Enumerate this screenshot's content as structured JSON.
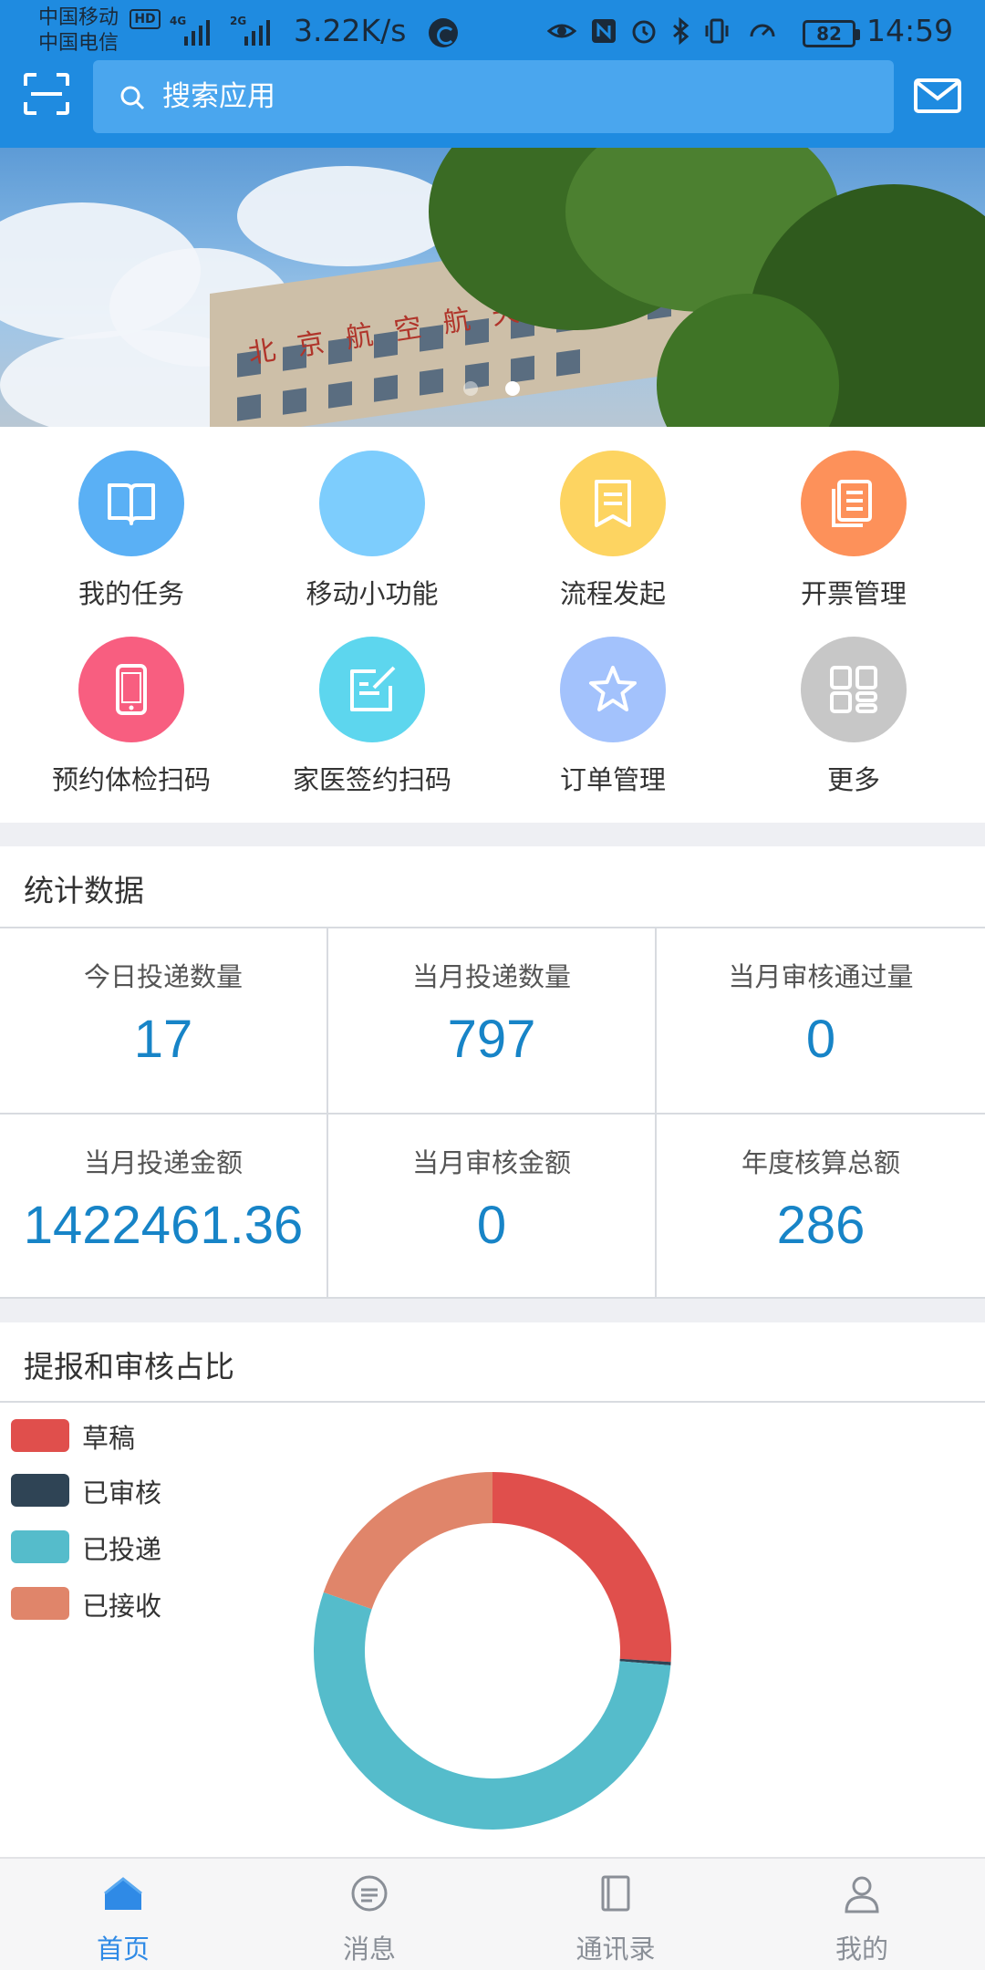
{
  "status_bar": {
    "carrier_1": "中国移动",
    "carrier_1_badge": "HD",
    "carrier_2": "中国电信",
    "signal_1_type": "4G",
    "signal_2_type": "2G",
    "net_speed": "3.22K/s",
    "battery": "82",
    "time": "14:59"
  },
  "header": {
    "search_placeholder": "搜索应用",
    "scan_icon": "scan-icon",
    "mail_icon": "mail-icon",
    "accent_color": "#1f8be0"
  },
  "banner": {
    "sign_text": "北京航空航天",
    "page_count": 2,
    "active_page": 2
  },
  "apps": [
    {
      "label": "我的任务",
      "color": "#5ab0f5",
      "icon": "book-icon"
    },
    {
      "label": "移动小功能",
      "color": "#7dcdfd",
      "icon": "blank-icon"
    },
    {
      "label": "流程发起",
      "color": "#fdd461",
      "icon": "document-icon"
    },
    {
      "label": "开票管理",
      "color": "#fd915a",
      "icon": "invoice-icon"
    },
    {
      "label": "预约体检扫码",
      "color": "#f85e80",
      "icon": "phone-icon"
    },
    {
      "label": "家医签约扫码",
      "color": "#5dd6ee",
      "icon": "edit-icon"
    },
    {
      "label": "订单管理",
      "color": "#a3c2fc",
      "icon": "star-icon"
    },
    {
      "label": "更多",
      "color": "#c7c7c7",
      "icon": "grid-icon"
    }
  ],
  "stats": {
    "title": "统计数据",
    "value_color": "#1784c7",
    "items": [
      {
        "label": "今日投递数量",
        "value": "17"
      },
      {
        "label": "当月投递数量",
        "value": "797"
      },
      {
        "label": "当月审核通过量",
        "value": "0"
      },
      {
        "label": "当月投递金额",
        "value": "1422461.36"
      },
      {
        "label": "当月审核金额",
        "value": "0"
      },
      {
        "label": "年度核算总额",
        "value": "286"
      }
    ]
  },
  "chart_section": {
    "title": "提报和审核占比"
  },
  "chart_data": {
    "type": "pie",
    "donut": true,
    "categories": [
      "草稿",
      "已审核",
      "已投递",
      "已接收"
    ],
    "values": [
      26,
      0.3,
      54,
      19.7
    ],
    "colors": [
      "#e04f4c",
      "#2f4455",
      "#55bccb",
      "#e0856a"
    ],
    "legend_position": "top-left"
  },
  "tabbar": {
    "tabs": [
      {
        "label": "首页",
        "icon": "home-icon",
        "active": true
      },
      {
        "label": "消息",
        "icon": "message-icon",
        "active": false
      },
      {
        "label": "通讯录",
        "icon": "contacts-icon",
        "active": false
      },
      {
        "label": "我的",
        "icon": "profile-icon",
        "active": false
      }
    ]
  }
}
